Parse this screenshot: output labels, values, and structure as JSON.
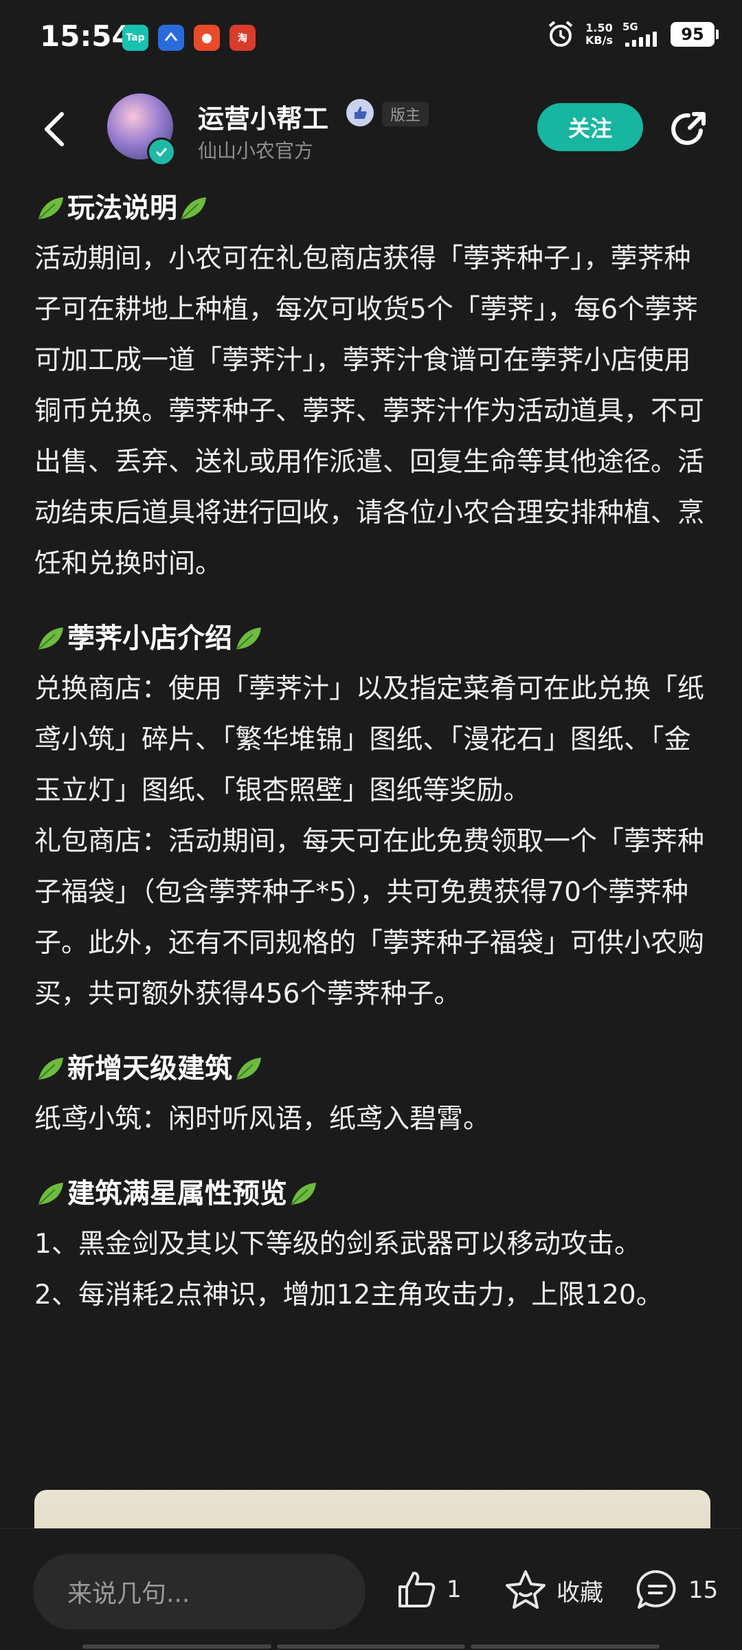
{
  "status_bar": {
    "time": "15:54",
    "apps": [
      {
        "label": "Tap",
        "color": "#18c1b0"
      },
      {
        "label": "",
        "color": "#2a6bdc"
      },
      {
        "label": "",
        "color": "#e94a2a"
      },
      {
        "label": "淘",
        "color": "#d93b2b"
      }
    ],
    "net_speed_value": "1.50",
    "net_speed_unit": "KB/s",
    "network": "5G",
    "battery": "95"
  },
  "header": {
    "author_name": "运营小帮工",
    "mod_tag": "版主",
    "author_subtitle": "仙山小农官方",
    "follow_label": "关注"
  },
  "sections": [
    {
      "title": "玩法说明",
      "paragraphs": [
        "活动期间，小农可在礼包商店获得「荸荠种子」，荸荠种子可在耕地上种植，每次可收货5个「荸荠」，每6个荸荠可加工成一道「荸荠汁」，荸荠汁食谱可在荸荠小店使用铜币兑换。荸荠种子、荸荠、荸荠汁作为活动道具，不可出售、丢弃、送礼或用作派遣、回复生命等其他途径。活动结束后道具将进行回收，请各位小农合理安排种植、烹饪和兑换时间。"
      ]
    },
    {
      "title": "荸荠小店介绍",
      "paragraphs": [
        "兑换商店：使用「荸荠汁」以及指定菜肴可在此兑换「纸鸢小筑」碎片、「繁华堆锦」图纸、「漫花石」图纸、「金玉立灯」图纸、「银杏照壁」图纸等奖励。",
        "礼包商店：活动期间，每天可在此免费领取一个「荸荠种子福袋」（包含荸荠种子*5），共可免费获得70个荸荠种子。此外，还有不同规格的「荸荠种子福袋」可供小农购买，共可额外获得456个荸荠种子。"
      ]
    },
    {
      "title": "新增天级建筑",
      "paragraphs": [
        "纸鸢小筑：闲时听风语，纸鸢入碧霄。"
      ]
    },
    {
      "title": "建筑满星属性预览",
      "paragraphs": [
        "1、黑金剑及其以下等级的剑系武器可以移动攻击。",
        "2、每消耗2点神识，增加12主角攻击力，上限120。"
      ]
    }
  ],
  "bottom_bar": {
    "comment_placeholder": "来说几句...",
    "like_count": "1",
    "collect_label": "收藏",
    "comment_count": "15"
  },
  "colors": {
    "background": "#1b1b1b",
    "accent": "#18b5a1",
    "text": "#f0f0f0",
    "muted": "#8e8e8e"
  }
}
